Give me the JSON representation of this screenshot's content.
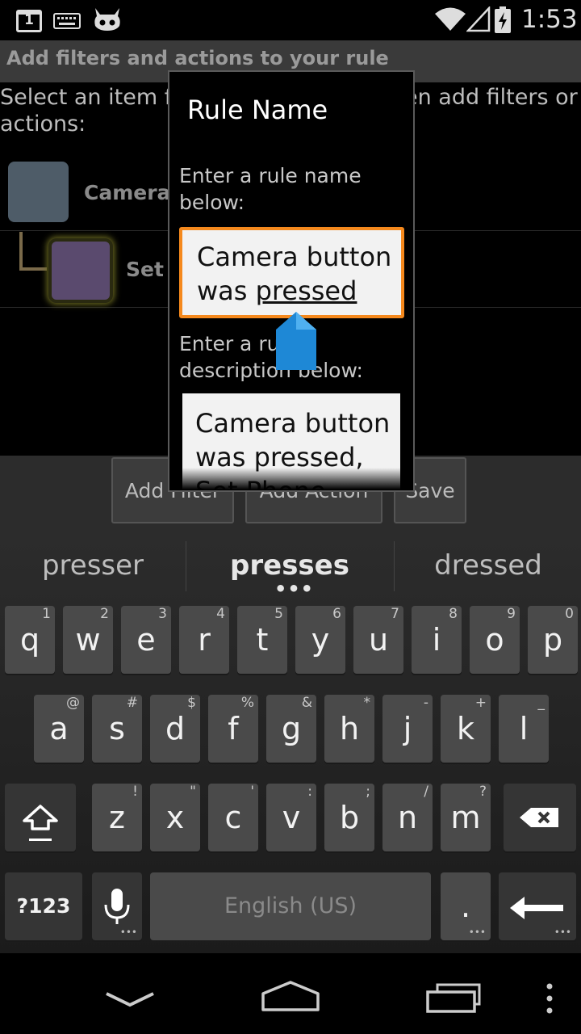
{
  "status_bar": {
    "time": "1:53",
    "calendar_day": "1",
    "icons": [
      "calendar-icon",
      "keyboard-icon",
      "cyanogen-robot-icon",
      "wifi-icon",
      "signal-icon",
      "battery-charging-icon"
    ]
  },
  "app": {
    "title": "Add filters and actions to your rule",
    "instruction": "Select an item from the list below, then add filters or actions:",
    "rule_label": "Camera button was pressed",
    "action_label": "Set Phone",
    "buttons": {
      "add_filter": "Add Filter",
      "add_action": "Add Action",
      "save": "Save"
    }
  },
  "dialog": {
    "title": "Rule Name",
    "name_label": "Enter a rule name below:",
    "name_value_plain": "Camera button was ",
    "name_value_underlined": "pressed",
    "desc_label": "Enter a rule description below:",
    "desc_value": "Camera button was pressed, Set Phone",
    "accent_color": "#f5891d"
  },
  "keyboard": {
    "suggestions": [
      "presser",
      "presses",
      "dressed"
    ],
    "row1": [
      {
        "k": "q",
        "h": "1"
      },
      {
        "k": "w",
        "h": "2"
      },
      {
        "k": "e",
        "h": "3"
      },
      {
        "k": "r",
        "h": "4"
      },
      {
        "k": "t",
        "h": "5"
      },
      {
        "k": "y",
        "h": "6"
      },
      {
        "k": "u",
        "h": "7"
      },
      {
        "k": "i",
        "h": "8"
      },
      {
        "k": "o",
        "h": "9"
      },
      {
        "k": "p",
        "h": "0"
      }
    ],
    "row2": [
      {
        "k": "a",
        "h": "@"
      },
      {
        "k": "s",
        "h": "#"
      },
      {
        "k": "d",
        "h": "$"
      },
      {
        "k": "f",
        "h": "%"
      },
      {
        "k": "g",
        "h": "&"
      },
      {
        "k": "h",
        "h": "*"
      },
      {
        "k": "j",
        "h": "-"
      },
      {
        "k": "k",
        "h": "+"
      },
      {
        "k": "l",
        "h": "_"
      }
    ],
    "row3": [
      {
        "k": "z",
        "h": "!"
      },
      {
        "k": "x",
        "h": "\""
      },
      {
        "k": "c",
        "h": "'"
      },
      {
        "k": "v",
        "h": ":"
      },
      {
        "k": "b",
        "h": ";"
      },
      {
        "k": "n",
        "h": "/"
      },
      {
        "k": "m",
        "h": "?"
      }
    ],
    "symbols_label": "?123",
    "space_label": "English (US)",
    "period_label": "."
  },
  "navigation": {
    "icons": [
      "back-icon",
      "home-icon",
      "recent-apps-icon",
      "menu-icon"
    ]
  }
}
